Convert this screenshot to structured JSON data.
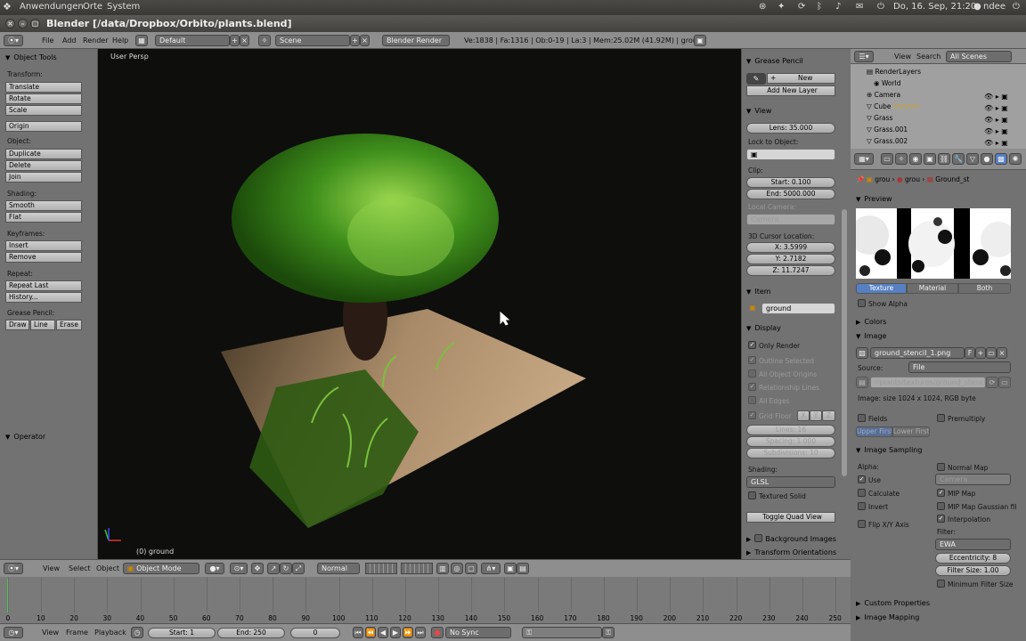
{
  "gnome_panel": {
    "menus": [
      "Anwendungen",
      "Orte",
      "System"
    ],
    "clock": "Do, 16. Sep, 21:20",
    "user": "ndee"
  },
  "window": {
    "title": "Blender [/data/Dropbox/Orbito/plants.blend]"
  },
  "info_header": {
    "menus": [
      "File",
      "Add",
      "Render",
      "Help"
    ],
    "layout": "Default",
    "scene": "Scene",
    "engine": "Blender Render",
    "stats": "Ve:1838 | Fa:1316 | Ob:0-19 | La:3 | Mem:25.02M (41.92M) | ground"
  },
  "object_tools": {
    "title": "Object Tools",
    "sections": [
      {
        "label": "Transform:",
        "buttons": [
          "Translate",
          "Rotate",
          "Scale"
        ]
      },
      {
        "label": "",
        "buttons": [
          "Origin"
        ]
      },
      {
        "label": "Object:",
        "buttons": [
          "Duplicate",
          "Delete",
          "Join"
        ]
      },
      {
        "label": "Shading:",
        "buttons": [
          "Smooth",
          "Flat"
        ]
      },
      {
        "label": "Keyframes:",
        "buttons": [
          "Insert",
          "Remove"
        ]
      },
      {
        "label": "Repeat:",
        "buttons": [
          "Repeat Last",
          "History..."
        ]
      }
    ],
    "grease_label": "Grease Pencil:",
    "grease_buttons": [
      "Draw",
      "Line",
      "Erase"
    ],
    "operator": "Operator"
  },
  "viewport": {
    "view_name": "User Persp",
    "object_info": "(0) ground",
    "colors": {
      "background": "#0e0e0c",
      "foliage": "#3f8f1c",
      "foliage_light": "#8fd04a",
      "ground": "#a88a68",
      "grass": "#2d5a12"
    }
  },
  "npanel": {
    "grease_pencil": {
      "title": "Grease Pencil",
      "new": "New",
      "add_layer": "Add New Layer"
    },
    "view": {
      "title": "View",
      "lens": "Lens: 35.000",
      "lock_label": "Lock to Object:",
      "clip_label": "Clip:",
      "clip_start": "Start: 0.100",
      "clip_end": "End: 5000.000",
      "local_camera": "Local Camera:",
      "camera": "Camera",
      "cursor_label": "3D Cursor Location:",
      "cursor_x": "X: 3.5999",
      "cursor_y": "Y: 2.7182",
      "cursor_z": "Z: 11.7247"
    },
    "item": {
      "title": "Item",
      "name": "ground"
    },
    "display": {
      "title": "Display",
      "only_render": "Only Render",
      "outline_selected": "Outline Selected",
      "all_object_origins": "All Object Origins",
      "relationship_lines": "Relationship Lines",
      "all_edges": "All Edges",
      "grid_floor": "Grid Floor",
      "axes": [
        "X",
        "Y",
        "Z"
      ],
      "lines": "Lines: 16",
      "spacing": "Spacing: 1.000",
      "subdivisions": "Subdivisions: 10",
      "shading_label": "Shading:",
      "shading": "GLSL",
      "textured_solid": "Textured Solid",
      "toggle_quad": "Toggle Quad View"
    },
    "background_images": "Background Images",
    "transform_orientations": "Transform Orientations"
  },
  "outliner": {
    "menus": [
      "View",
      "Search"
    ],
    "filter": "All Scenes",
    "items": [
      "RenderLayers",
      "World",
      "Camera",
      "Cube",
      "Grass",
      "Grass.001",
      "Grass.002"
    ]
  },
  "properties": {
    "breadcrumb": [
      "grou",
      "grou",
      "Ground_st"
    ],
    "preview": "Preview",
    "preview_tabs": [
      "Texture",
      "Material",
      "Both"
    ],
    "show_alpha": "Show Alpha",
    "colors": "Colors",
    "image": "Image",
    "image_name": "ground_stencil_1.png",
    "image_flag": "F",
    "source_label": "Source:",
    "source": "File",
    "filepath": "//plants/textures/ground_stencil_1.png",
    "image_info": "Image: size 1024 x 1024, RGB byte",
    "fields": "Fields",
    "premultiply": "Premultiply",
    "upper_first": "Upper First",
    "lower_first": "Lower First",
    "image_sampling": "Image Sampling",
    "alpha_label": "Alpha:",
    "use": "Use",
    "normal_map": "Normal Map",
    "camera": "Camera",
    "calculate": "Calculate",
    "mip_map": "MIP Map",
    "invert": "Invert",
    "mip_map_gaussian": "MIP Map Gaussian fil",
    "interpolation": "Interpolation",
    "flip_xy": "Flip X/Y Axis",
    "filter_label": "Filter:",
    "filter": "EWA",
    "eccentricity": "Eccentricity: 8",
    "filter_size": "Filter Size: 1.00",
    "min_filter": "Minimum Filter Size",
    "custom_properties": "Custom Properties",
    "image_mapping": "Image Mapping"
  },
  "view3d_header": {
    "menus": [
      "View",
      "Select",
      "Object"
    ],
    "mode": "Object Mode",
    "pivot": "Normal"
  },
  "timeline": {
    "ticks": [
      0,
      10,
      20,
      30,
      40,
      50,
      60,
      70,
      80,
      90,
      100,
      110,
      120,
      130,
      140,
      150,
      160,
      170,
      180,
      190,
      200,
      210,
      220,
      230,
      240,
      250
    ],
    "current_frame_marker": 0,
    "menus": [
      "View",
      "Frame",
      "Playback"
    ],
    "start": "Start: 1",
    "end": "End: 250",
    "current": "0",
    "sync": "No Sync"
  }
}
